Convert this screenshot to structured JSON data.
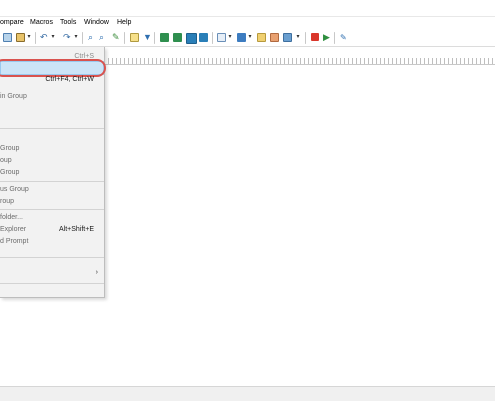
{
  "menubar": {
    "items": [
      "ompare",
      "Macros",
      "Tools",
      "Window",
      "Help"
    ]
  },
  "toolbar": {
    "icons": [
      "copy-icon",
      "paste-icon",
      "dropdown-arrow",
      "undo-icon",
      "undo-dropdown",
      "redo-icon",
      "redo-dropdown",
      "find-icon",
      "replace-icon",
      "find-in-files-icon",
      "highlight-icon",
      "filter-icon",
      "column-mode-icon",
      "hex-mode-icon",
      "word-wrap-icon",
      "compare-icon",
      "spell-check-icon",
      "dropdown-arrow",
      "color-picker-icon",
      "dropdown-arrow",
      "script-icon",
      "macro-icon",
      "template-icon",
      "dropdown-arrow",
      "stop-record-icon",
      "play-macro-icon",
      "run-icon"
    ]
  },
  "menu": {
    "items": [
      {
        "label": "",
        "shortcut": "Ctrl+S"
      },
      {
        "label": "",
        "shortcut": ""
      },
      {
        "label": "",
        "shortcut": "Ctrl+F4, Ctrl+W"
      },
      {
        "label": "in Group",
        "shortcut": ""
      },
      {
        "label": "Group",
        "shortcut": ""
      },
      {
        "label": "oup",
        "shortcut": ""
      },
      {
        "label": "Group",
        "shortcut": ""
      },
      {
        "label": "us Group",
        "shortcut": ""
      },
      {
        "label": "roup",
        "shortcut": ""
      },
      {
        "label": "folder...",
        "shortcut": ""
      },
      {
        "label": "Explorer",
        "shortcut": "Alt+Shift+E"
      },
      {
        "label": "d Prompt",
        "shortcut": ""
      },
      {
        "label": "",
        "shortcut": ""
      },
      {
        "label": "",
        "shortcut": ""
      }
    ]
  }
}
